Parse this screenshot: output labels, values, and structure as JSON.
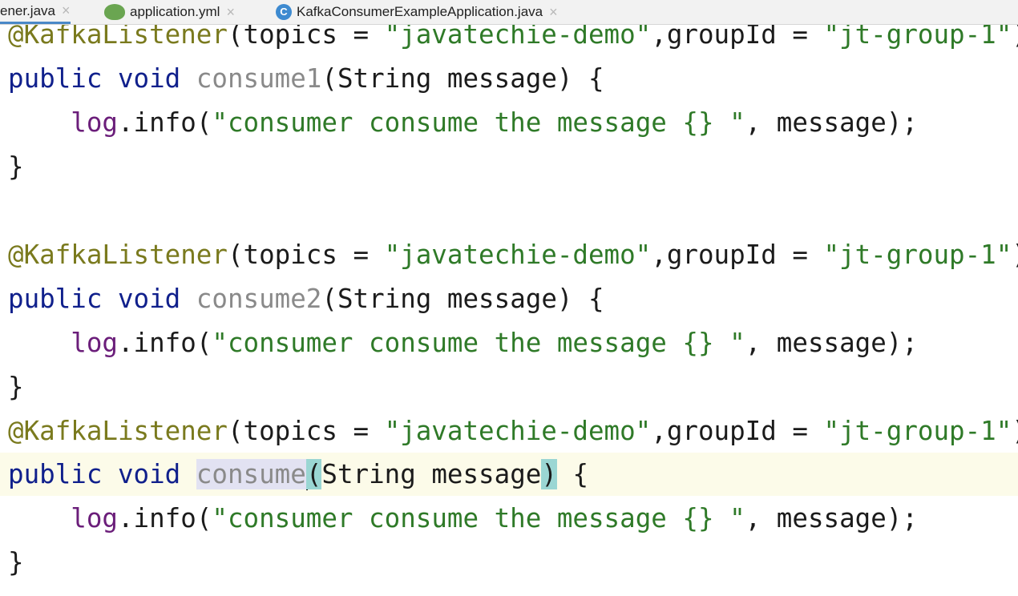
{
  "tabs": [
    {
      "label": "ener.java",
      "active": true
    },
    {
      "label": "application.yml",
      "icon": "yml-file-icon"
    },
    {
      "label": "KafkaConsumerExampleApplication.java",
      "icon": "java-class-icon",
      "icon_letter": "C"
    }
  ],
  "close_glyph": "×",
  "code": {
    "block1": {
      "annotation": "@KafkaListener",
      "ann_args_1": "(topics = ",
      "topic": "\"javatechie-demo\"",
      "ann_args_2": ",groupId = ",
      "group": "\"jt-group-1\"",
      "ann_close": ")",
      "kw_public": "public",
      "kw_void": "void",
      "method": "consume1",
      "params": "(String message) {",
      "indent": "    ",
      "log": "log",
      "info": ".info(",
      "message_str": "\"consumer consume the message {} \"",
      "log_tail": ", message);",
      "close": "}"
    },
    "block2": {
      "annotation": "@KafkaListener",
      "ann_args_1": "(topics = ",
      "topic": "\"javatechie-demo\"",
      "ann_args_2": ",groupId = ",
      "group": "\"jt-group-1\"",
      "ann_close": ")",
      "kw_public": "public",
      "kw_void": "void",
      "method": "consume2",
      "params": "(String message) {",
      "indent": "    ",
      "log": "log",
      "info": ".info(",
      "message_str": "\"consumer consume the message {} \"",
      "log_tail": ", message);",
      "close": "}"
    },
    "block3": {
      "annotation": "@KafkaListener",
      "ann_args_1": "(topics = ",
      "topic": "\"javatechie-demo\"",
      "ann_args_2": ",groupId = ",
      "group": "\"jt-group-1\"",
      "ann_close": ")",
      "kw_public": "public",
      "kw_void": "void",
      "method": "consume",
      "paren_open": "(",
      "params_mid": "String message",
      "paren_close": ")",
      "params_end": " {",
      "indent": "    ",
      "log": "log",
      "info": ".info(",
      "message_str": "\"consumer consume the message {} \"",
      "log_tail": ", message);",
      "close": "}"
    }
  },
  "colors": {
    "annotation": "#7a7a1e",
    "keyword": "#10208c",
    "string": "#2f7a28",
    "unused_method": "#8a8a8a",
    "field": "#6b1e7a",
    "current_line": "#fcfbe9",
    "brace_match": "#9ad6d3",
    "active_tab_underline": "#4a88c7"
  }
}
